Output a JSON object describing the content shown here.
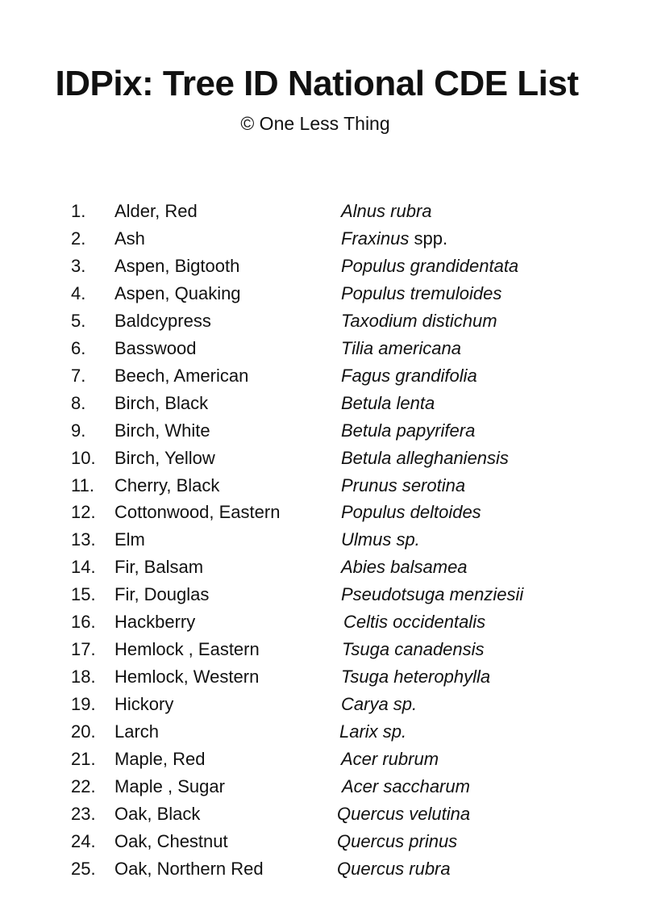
{
  "header": {
    "title": "IDPix: Tree ID National CDE List",
    "copyright": "© One Less Thing"
  },
  "trees": [
    {
      "number": "1.",
      "common": "Alder, Red",
      "scientific": "Alnus rubra",
      "suffix": ""
    },
    {
      "number": "2.",
      "common": "Ash",
      "scientific": "Fraxinus",
      "suffix": " spp."
    },
    {
      "number": "3.",
      "common": "Aspen, Bigtooth",
      "scientific": "Populus grandidentata",
      "suffix": ""
    },
    {
      "number": "4.",
      "common": "Aspen, Quaking",
      "scientific": "Populus tremuloides",
      "suffix": ""
    },
    {
      "number": "5.",
      "common": "Baldcypress",
      "scientific": "Taxodium distichum",
      "suffix": ""
    },
    {
      "number": "6.",
      "common": "Basswood",
      "scientific": "Tilia americana",
      "suffix": ""
    },
    {
      "number": "7.",
      "common": "Beech, American",
      "scientific": "Fagus grandifolia",
      "suffix": ""
    },
    {
      "number": "8.",
      "common": "Birch, Black",
      "scientific": "Betula lenta",
      "suffix": ""
    },
    {
      "number": "9.",
      "common": "Birch, White",
      "scientific": "Betula papyrifera",
      "suffix": ""
    },
    {
      "number": "10.",
      "common": "Birch, Yellow",
      "scientific": "Betula alleghaniensis",
      "suffix": ""
    },
    {
      "number": "11.",
      "common": "Cherry, Black",
      "scientific": "Prunus serotina",
      "suffix": ""
    },
    {
      "number": "12.",
      "common": "Cottonwood, Eastern",
      "scientific": "Populus deltoides",
      "suffix": ""
    },
    {
      "number": "13.",
      "common": "Elm",
      "scientific": "Ulmus sp.",
      "suffix": ""
    },
    {
      "number": "14.",
      "common": "Fir, Balsam",
      "scientific": "Abies balsamea",
      "suffix": ""
    },
    {
      "number": "15.",
      "common": "Fir, Douglas",
      "scientific": "Pseudotsuga menziesii",
      "suffix": ""
    },
    {
      "number": "16.",
      "common": "Hackberry",
      "scientific": "Celtis occidentalis",
      "suffix": ""
    },
    {
      "number": "17.",
      "common": "Hemlock , Eastern",
      "scientific": "Tsuga canadensis",
      "suffix": ""
    },
    {
      "number": "18.",
      "common": "Hemlock, Western",
      "scientific": "Tsuga heterophylla",
      "suffix": ""
    },
    {
      "number": "19.",
      "common": "Hickory",
      "scientific": "Carya sp.",
      "suffix": ""
    },
    {
      "number": "20.",
      "common": "Larch",
      "scientific": "Larix sp.",
      "suffix": ""
    },
    {
      "number": "21.",
      "common": "Maple, Red",
      "scientific": "Acer rubrum",
      "suffix": ""
    },
    {
      "number": "22.",
      "common": "Maple , Sugar",
      "scientific": "Acer saccharum",
      "suffix": ""
    },
    {
      "number": "23.",
      "common": "Oak, Black",
      "scientific": "Quercus velutina",
      "suffix": ""
    },
    {
      "number": "24.",
      "common": "Oak, Chestnut",
      "scientific": "Quercus prinus",
      "suffix": ""
    },
    {
      "number": "25.",
      "common": "Oak, Northern Red",
      "scientific": "Quercus rubra",
      "suffix": ""
    }
  ]
}
